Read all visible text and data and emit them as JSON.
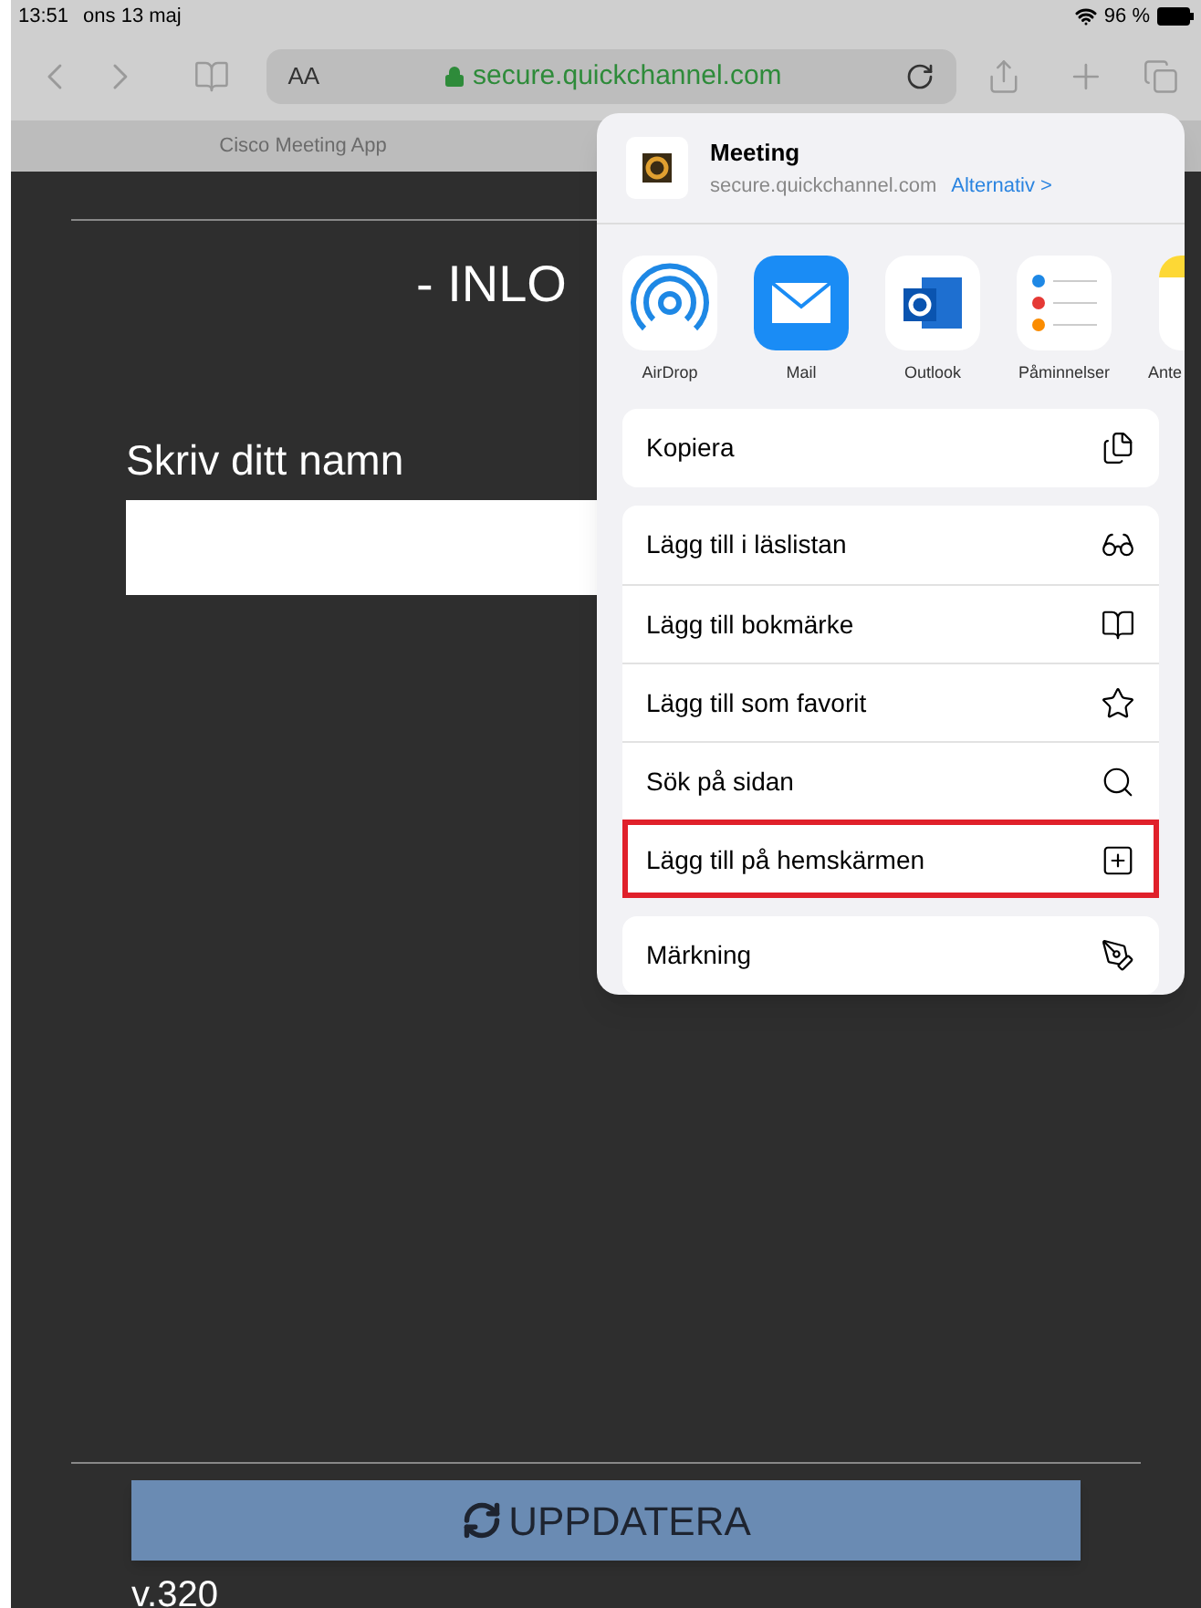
{
  "status_bar": {
    "time": "13:51",
    "date": "ons 13 maj",
    "battery": "96 %"
  },
  "toolbar": {
    "text_size_button": "AA",
    "url": "secure.quickchannel.com"
  },
  "tab": {
    "title": "Cisco Meeting App"
  },
  "page": {
    "heading": "- INLO",
    "name_label": "Skriv ditt namn",
    "update_button": "UPPDATERA",
    "version": "v.320"
  },
  "share_sheet": {
    "title": "Meeting",
    "url": "secure.quickchannel.com",
    "options_link": "Alternativ >",
    "apps": [
      {
        "name": "AirDrop",
        "kind": "airdrop"
      },
      {
        "name": "Mail",
        "kind": "mail"
      },
      {
        "name": "Outlook",
        "kind": "outlook"
      },
      {
        "name": "Påminnelser",
        "kind": "reminders"
      },
      {
        "name": "Ante",
        "kind": "notes"
      }
    ],
    "groups": [
      {
        "items": [
          {
            "label": "Kopiera",
            "kind": "copy",
            "highlighted": false
          }
        ]
      },
      {
        "items": [
          {
            "label": "Lägg till i läslistan",
            "kind": "glasses",
            "highlighted": false
          },
          {
            "label": "Lägg till bokmärke",
            "kind": "book",
            "highlighted": false
          },
          {
            "label": "Lägg till som favorit",
            "kind": "star",
            "highlighted": false
          },
          {
            "label": "Sök på sidan",
            "kind": "search",
            "highlighted": false
          },
          {
            "label": "Lägg till på hemskärmen",
            "kind": "add",
            "highlighted": true
          }
        ]
      },
      {
        "items": [
          {
            "label": "Märkning",
            "kind": "markup",
            "highlighted": false
          }
        ]
      }
    ]
  }
}
